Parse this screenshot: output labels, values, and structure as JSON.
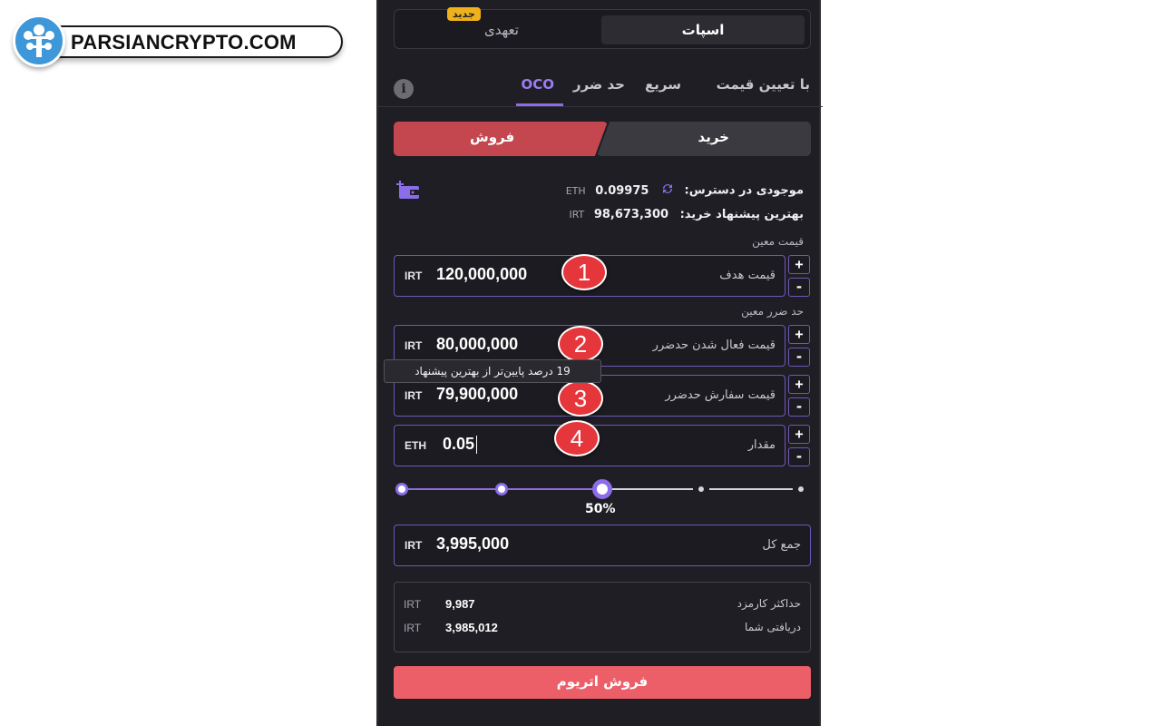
{
  "watermark": {
    "text": "PARSIANCRYPTO.COM"
  },
  "market_tabs": {
    "spot": "اسپات",
    "futures": "تعهدی",
    "new_badge": "جدید"
  },
  "order_tabs": {
    "limit": "با تعیین قیمت",
    "market": "سریع",
    "stop": "حد ضرر",
    "oco": "OCO",
    "info_icon": "i"
  },
  "side": {
    "buy": "خرید",
    "sell": "فروش"
  },
  "balance": {
    "label": "موجودی در دسترس:",
    "value": "0.09975",
    "unit": "ETH"
  },
  "best_bid": {
    "label": "بهترین پیشنهاد خرید:",
    "value": "98,673,300",
    "unit": "IRT"
  },
  "limit_section": {
    "label": "قیمت معین"
  },
  "target_price": {
    "label": "قیمت هدف",
    "value": "120,000,000",
    "unit": "IRT",
    "marker": "1"
  },
  "stop_section": {
    "label": "حد ضرر معین"
  },
  "stop_trigger": {
    "label": "قیمت فعال شدن حدضرر",
    "value": "80,000,000",
    "unit": "IRT",
    "marker": "2"
  },
  "tooltip": "19 درصد پایین‌تر از بهترین پیشنهاد",
  "stop_order": {
    "label": "قیمت سفارش حدضرر",
    "value": "79,900,000",
    "unit": "IRT",
    "marker": "3"
  },
  "amount": {
    "label": "مقدار",
    "value": "0.05",
    "unit": "ETH",
    "marker": "4"
  },
  "stepper": {
    "plus": "+",
    "minus": "-"
  },
  "slider": {
    "percent_label": "50%",
    "value_percent": 50
  },
  "total": {
    "label": "جمع کل",
    "value": "3,995,000",
    "unit": "IRT"
  },
  "fee": {
    "label": "حداکثر کارمزد",
    "value": "9,987",
    "unit": "IRT"
  },
  "receive": {
    "label": "دریافتی شما",
    "value": "3,985,012",
    "unit": "IRT"
  },
  "submit": {
    "label": "فروش اتریوم"
  },
  "colors": {
    "accent": "#8b6de8",
    "sell": "#c4474f",
    "submit": "#ec5f69",
    "marker": "#e5363c",
    "badge": "#f0b21b"
  }
}
